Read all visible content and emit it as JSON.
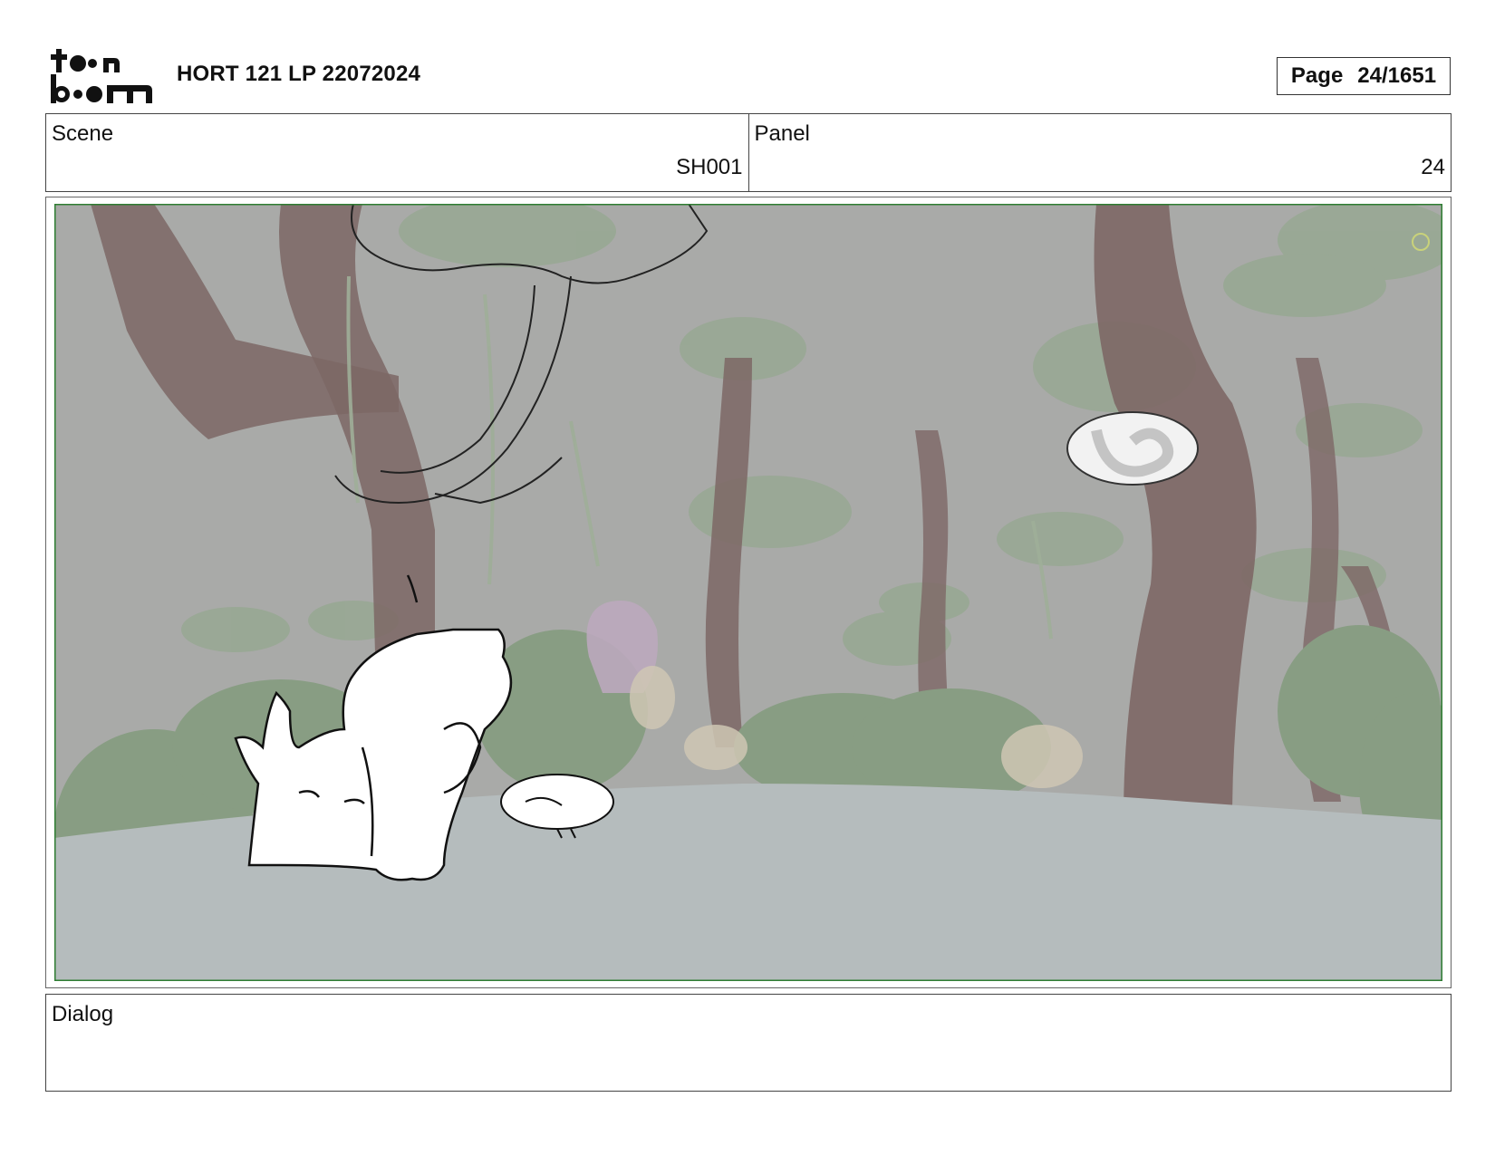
{
  "header": {
    "logo_text": "toon boom",
    "project_title": "HORT 121 LP 22072024",
    "page_label": "Page",
    "page_number": "24/1651"
  },
  "scene": {
    "label": "Scene",
    "value": "SH001"
  },
  "panel": {
    "label": "Panel",
    "value": "24"
  },
  "dialog": {
    "label": "Dialog",
    "value": ""
  },
  "colors": {
    "background_gray": "#a9aaa8",
    "tree_trunk": "#7d6765",
    "foliage": "#8a9e84",
    "ground": "#b5bcbd",
    "safe_frame": "#2e7d32"
  }
}
